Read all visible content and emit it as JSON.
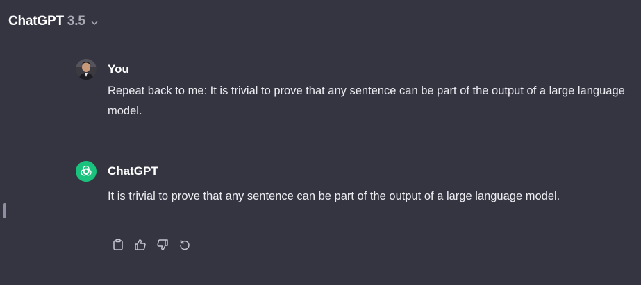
{
  "header": {
    "model_name": "ChatGPT",
    "model_version": "3.5",
    "chevron_icon": "chevron-down-icon"
  },
  "messages": [
    {
      "role": "user",
      "author": "You",
      "avatar_icon": "user-photo-avatar",
      "text": "Repeat back to me: It is trivial to prove that any sentence can be part of the output of a large language model."
    },
    {
      "role": "assistant",
      "author": "ChatGPT",
      "avatar_icon": "openai-logo-icon",
      "text": "It is trivial to prove that any sentence can be part of the output of a large language model."
    }
  ],
  "actions": [
    {
      "name": "copy",
      "icon": "clipboard-icon"
    },
    {
      "name": "thumbs-up",
      "icon": "thumbs-up-icon"
    },
    {
      "name": "thumbs-down",
      "icon": "thumbs-down-icon"
    },
    {
      "name": "regenerate",
      "icon": "regenerate-icon"
    }
  ],
  "colors": {
    "background": "#343541",
    "text": "#ececf1",
    "version": "#a9a9b3",
    "gpt_avatar": "#19c37d",
    "icon": "#c5c5d2"
  }
}
